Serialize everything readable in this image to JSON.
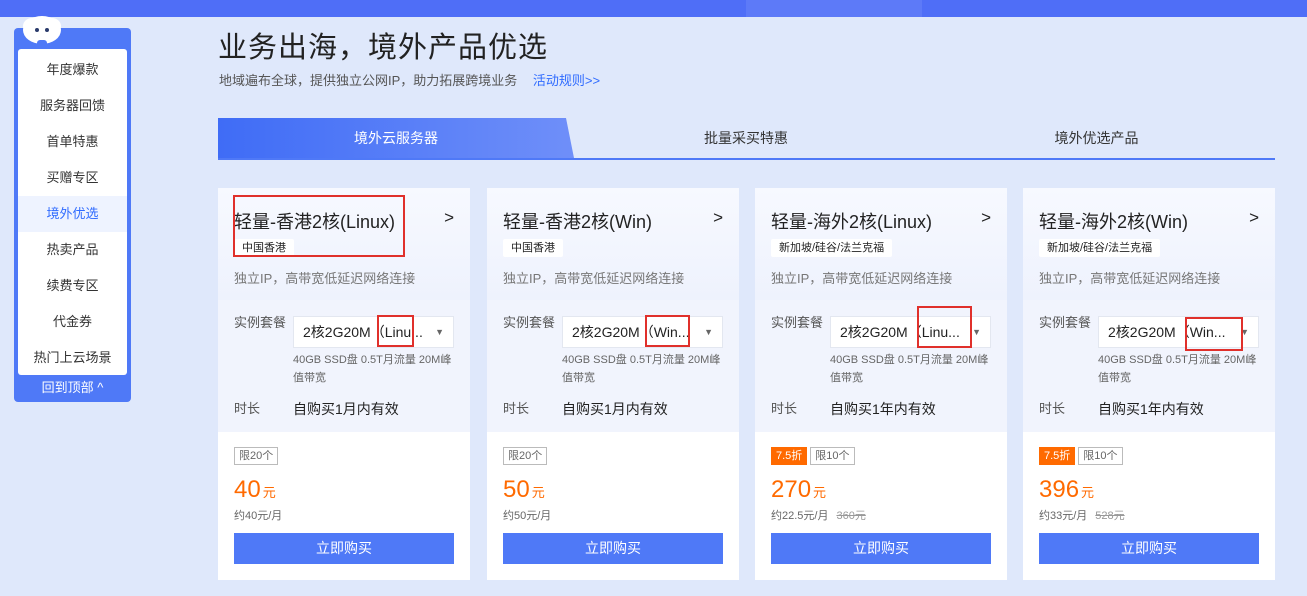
{
  "sidenav": {
    "items": [
      {
        "label": "年度爆款"
      },
      {
        "label": "服务器回馈"
      },
      {
        "label": "首单特惠"
      },
      {
        "label": "买赠专区"
      },
      {
        "label": "境外优选"
      },
      {
        "label": "热卖产品"
      },
      {
        "label": "续费专区"
      },
      {
        "label": "代金券"
      },
      {
        "label": "热门上云场景"
      }
    ],
    "active_index": 4,
    "back_to_top": "回到顶部 ^"
  },
  "header": {
    "title": "业务出海，境外产品优选",
    "subtitle": "地域遍布全球，提供独立公网IP，助力拓展跨境业务",
    "rules_link": "活动规则>>"
  },
  "tabs": [
    {
      "label": "境外云服务器",
      "active": true
    },
    {
      "label": "批量采买特惠",
      "active": false
    },
    {
      "label": "境外优选产品",
      "active": false
    }
  ],
  "labels": {
    "instance": "实例套餐",
    "duration": "时长",
    "buy": "立即购买",
    "arrow": ">"
  },
  "products": [
    {
      "name": "轻量-香港2核(Linux)",
      "region": "中国香港",
      "desc": "独立IP，高带宽低延迟网络连接",
      "package": "2核2G20M（Linu...",
      "spec": "40GB SSD盘 0.5T月流量 20M峰值带宽",
      "duration": "自购买1月内有效",
      "discount": "",
      "limit": "限20个",
      "price": "40",
      "unit": "元",
      "per_month": "约40元/月",
      "original": ""
    },
    {
      "name": "轻量-香港2核(Win)",
      "region": "中国香港",
      "desc": "独立IP，高带宽低延迟网络连接",
      "package": "2核2G20M（Win...",
      "spec": "40GB SSD盘 0.5T月流量 20M峰值带宽",
      "duration": "自购买1月内有效",
      "discount": "",
      "limit": "限20个",
      "price": "50",
      "unit": "元",
      "per_month": "约50元/月",
      "original": ""
    },
    {
      "name": "轻量-海外2核(Linux)",
      "region": "新加坡/硅谷/法兰克福",
      "desc": "独立IP，高带宽低延迟网络连接",
      "package": "2核2G20M（Linu...",
      "spec": "40GB SSD盘 0.5T月流量 20M峰值带宽",
      "duration": "自购买1年内有效",
      "discount": "7.5折",
      "limit": "限10个",
      "price": "270",
      "unit": "元",
      "per_month": "约22.5元/月",
      "original": "360元"
    },
    {
      "name": "轻量-海外2核(Win)",
      "region": "新加坡/硅谷/法兰克福",
      "desc": "独立IP，高带宽低延迟网络连接",
      "package": "2核2G20M（Win...",
      "spec": "40GB SSD盘 0.5T月流量 20M峰值带宽",
      "duration": "自购买1年内有效",
      "discount": "7.5折",
      "limit": "限10个",
      "price": "396",
      "unit": "元",
      "per_month": "约33元/月",
      "original": "528元"
    }
  ],
  "colors": {
    "accent": "#4f79f7",
    "price": "#ff6a00",
    "annotation": "#e0302b",
    "page_bg": "#dfe8fb"
  }
}
